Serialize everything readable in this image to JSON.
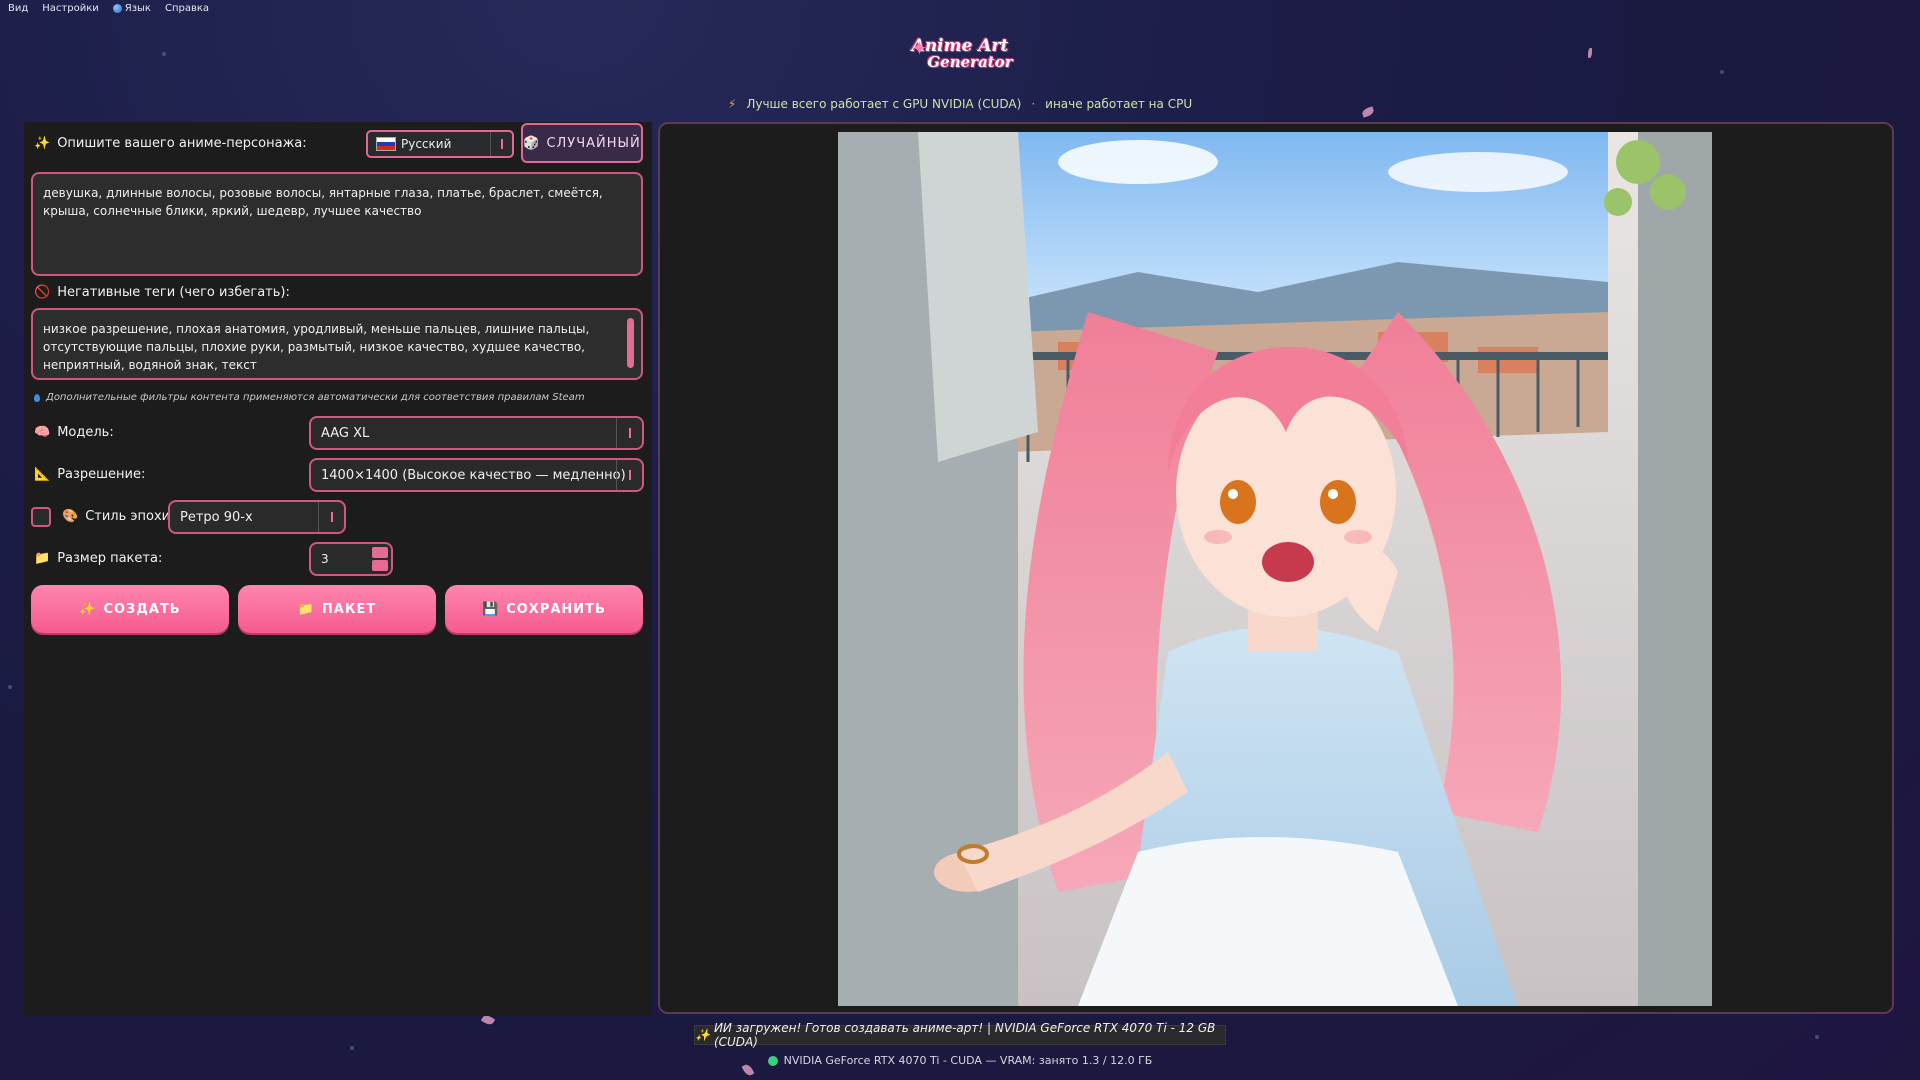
{
  "menu": {
    "items": [
      "Вид",
      "Настройки",
      "Язык",
      "Справка"
    ]
  },
  "logo": {
    "line1": "Anime Art",
    "line2": "Generator"
  },
  "subtitle": {
    "part1": "Лучше всего работает с GPU NVIDIA (CUDA)",
    "separator": "·",
    "part2": "иначе работает на CPU"
  },
  "prompt": {
    "label": "Опишите вашего аниме-персонажа:",
    "value": "девушка, длинные волосы, розовые волосы, янтарные глаза, платье, браслет, смеётся, крыша, солнечные блики, яркий, шедевр, лучшее качество"
  },
  "language": {
    "selected": "Русский"
  },
  "random_button": "СЛУЧАЙНЫЙ",
  "negative": {
    "label": "Негативные теги (чего избегать):",
    "value": "низкое разрешение, плохая анатомия, уродливый, меньше пальцев, лишние пальцы, отсутствующие пальцы, плохие руки, размытый, низкое качество, худшее качество, неприятный, водяной знак, текст"
  },
  "filter_note": "Дополнительные фильтры контента применяются автоматически для соответствия правилам Steam",
  "model": {
    "label": "Модель:",
    "selected": "AAG XL"
  },
  "resolution": {
    "label": "Разрешение:",
    "selected": "1400×1400 (Высокое качество — медленно)"
  },
  "era_style": {
    "label": "Стиль эпохи:",
    "selected": "Ретро 90-х",
    "checked": false
  },
  "batch": {
    "label": "Размер пакета:",
    "value": "3"
  },
  "buttons": {
    "create": "СОЗДАТЬ",
    "batch": "ПАКЕТ",
    "save": "СОХРАНИТЬ"
  },
  "status": {
    "message": "ИИ загружен! Готов создавать аниме-арт! | NVIDIA GeForce RTX 4070 Ti - 12 GB (CUDA)",
    "gpu_line": "NVIDIA GeForce RTX 4070 Ti - CUDA — VRAM: занято 1.3 / 12.0 ГБ"
  },
  "colors": {
    "accent": "#f06c9b",
    "panel": "#1c1c1c",
    "status_ok": "#3ad07a"
  }
}
